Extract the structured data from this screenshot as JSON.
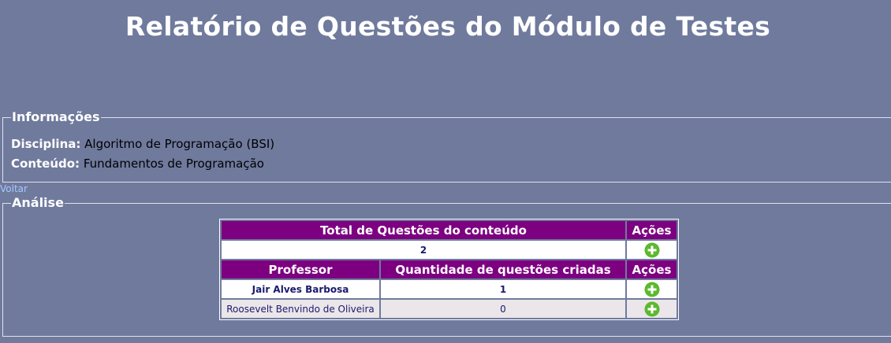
{
  "page_title": "Relatório de Questões do Módulo de Testes",
  "info": {
    "legend": "Informações",
    "disciplina_label": "Disciplina:",
    "disciplina_value": "Algoritmo de Programação (BSI)",
    "conteudo_label": "Conteúdo:",
    "conteudo_value": "Fundamentos de Programação"
  },
  "voltar_label": "Voltar",
  "analise": {
    "legend": "Análise",
    "total_header": "Total de Questões do conteúdo",
    "acoes_header": "Ações",
    "total_value": "2",
    "professor_header": "Professor",
    "quantidade_header": "Quantidade de questões criadas",
    "rows": [
      {
        "professor": "Jair Alves Barbosa",
        "quantidade": "1"
      },
      {
        "professor": "Roosevelt Benvindo de Oliveira",
        "quantidade": "0"
      }
    ]
  },
  "icons": {
    "add": "plus-circle-icon"
  },
  "colors": {
    "background": "#6f7a9d",
    "header": "#7d0080",
    "add_icon": "#5cb82e",
    "link": "#a9c8ff"
  }
}
